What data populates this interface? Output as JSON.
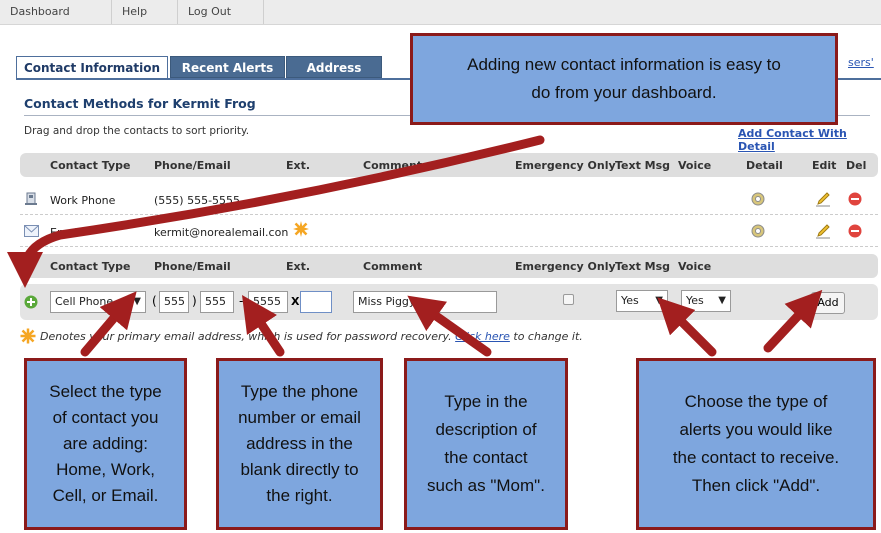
{
  "nav": {
    "items": [
      "Dashboard",
      "Help",
      "Log Out"
    ]
  },
  "tabs": [
    "Contact Information",
    "Recent Alerts",
    "Address"
  ],
  "top_link": "sers'",
  "section": {
    "title": "Contact Methods for Kermit Frog",
    "hint": "Drag and drop the contacts to sort priority.",
    "add_link": "Add Contact With Detail"
  },
  "table": {
    "headers": [
      "Contact Type",
      "Phone/Email",
      "Ext.",
      "Comment",
      "Emergency Only",
      "Text Msg",
      "Voice",
      "Detail",
      "Edit",
      "Del"
    ],
    "rows": [
      {
        "type": "Work Phone",
        "value": "(555) 555-5555"
      },
      {
        "type": "Email",
        "value": "kermit@norealemail.con"
      }
    ]
  },
  "add_row": {
    "headers": [
      "Contact Type",
      "Phone/Email",
      "Ext.",
      "Comment",
      "Emergency Only",
      "Text Msg",
      "Voice"
    ],
    "contact_type": "Cell Phone",
    "paren_open": "(",
    "area": "555",
    "paren_close": ")",
    "prefix": "555",
    "dash": "-",
    "line": "5555",
    "ext_label": "X",
    "ext": "",
    "comment": "Miss Piggy",
    "text_msg": "Yes",
    "voice": "Yes",
    "add_button": "Add"
  },
  "note": {
    "before": "Denotes your primary email address, which is used for password recovery.",
    "link": "Click here",
    "after": "to change it."
  },
  "callouts": {
    "top": [
      "Adding new contact information is easy to",
      "do from your dashboard."
    ],
    "type": [
      "Select the type",
      "of contact you",
      "are adding:",
      "Home, Work,",
      "Cell, or Email."
    ],
    "phone": [
      "Type the phone",
      "number or email",
      "address in the",
      "blank directly to",
      "the right."
    ],
    "comment": [
      "Type in the",
      "description of",
      "the contact",
      "such as \"Mom\"."
    ],
    "alerts": [
      "Choose the type of",
      "alerts you would like",
      "the contact to receive.",
      "Then click \"Add\"."
    ]
  },
  "colors": {
    "callout_fill": "#7ea6de",
    "callout_border": "#8b1a1a",
    "arrow": "#a31f1f",
    "tab_active_text": "#1f3a66",
    "tab_inactive_bg": "#4a6b92",
    "link": "#2a55b3"
  },
  "icons": [
    "phone-icon",
    "email-icon",
    "gear-icon",
    "pencil-icon",
    "delete-icon",
    "add-icon",
    "star-icon",
    "chevron-down-icon"
  ]
}
